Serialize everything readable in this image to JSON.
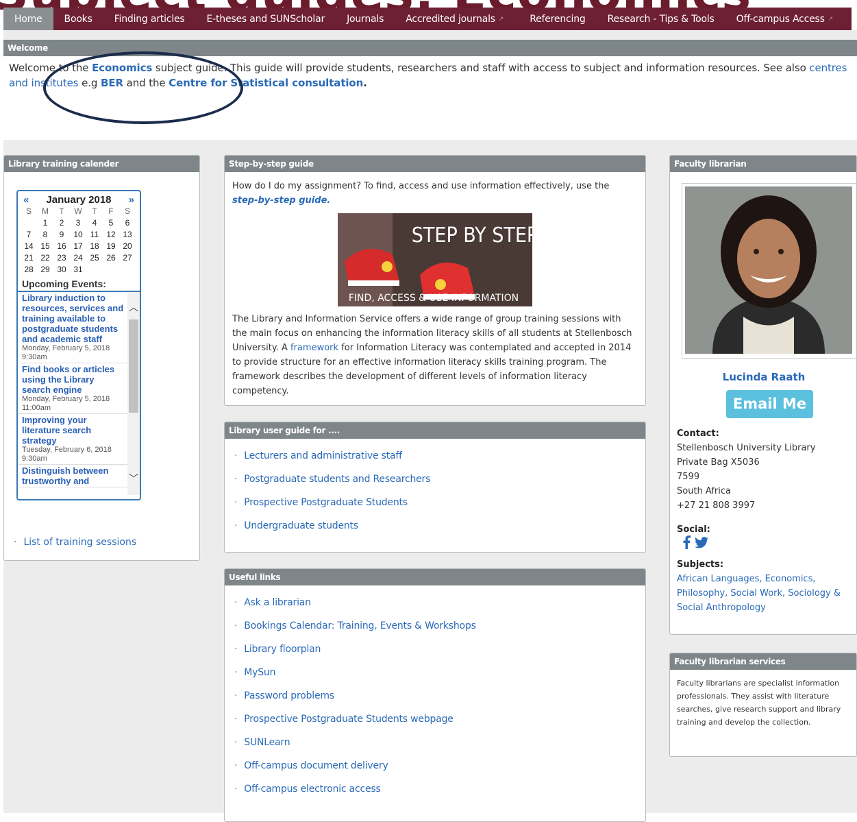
{
  "banner_text": "Subject guides: Economics",
  "nav": {
    "tabs": [
      {
        "label": "Home"
      },
      {
        "label": "Books"
      },
      {
        "label": "Finding articles"
      },
      {
        "label": "E-theses and SUNScholar"
      },
      {
        "label": "Journals"
      },
      {
        "label": "Accredited journals"
      },
      {
        "label": "Referencing"
      },
      {
        "label": "Research - Tips & Tools"
      },
      {
        "label": "Off-campus Access"
      }
    ]
  },
  "welcome": {
    "header": "Welcome",
    "t1": "Welcome to the ",
    "economics": "Economics",
    "t2": " subject guide. This guide will provide students, researchers and staff with access to subject and information resources. See also ",
    "centres": "centres and institutes",
    "t3": " e.g ",
    "ber": "BER",
    "t4": " and the ",
    "centre": "Centre for Statistical consultation",
    "t5": "."
  },
  "training": {
    "header": "Library training calender",
    "month": "January 2018",
    "prev": "«",
    "next": "»",
    "dows": [
      "S",
      "M",
      "T",
      "W",
      "T",
      "F",
      "S"
    ],
    "days": [
      "",
      "1",
      "2",
      "3",
      "4",
      "5",
      "6",
      "7",
      "8",
      "9",
      "10",
      "11",
      "12",
      "13",
      "14",
      "15",
      "16",
      "17",
      "18",
      "19",
      "20",
      "21",
      "22",
      "23",
      "24",
      "25",
      "26",
      "27",
      "28",
      "29",
      "30",
      "31",
      "",
      "",
      ""
    ],
    "upcoming_title": "Upcoming Events:",
    "events": [
      {
        "title": "Library induction to resources, services and training available to postgraduate students and academic staff",
        "date": "Monday, February 5, 2018 9:30am"
      },
      {
        "title": "Find books or articles using the Library search engine",
        "date": "Monday, February 5, 2018 11:00am"
      },
      {
        "title": "Improving your literature search strategy",
        "date": "Tuesday, February 6, 2018 9:30am"
      },
      {
        "title": "Distinguish between trustworthy and",
        "date": ""
      }
    ],
    "list_link": "List of training sessions"
  },
  "step": {
    "header": "Step-by-step guide",
    "q": "How do I do my assignment? To find, access and use information effectively, use the ",
    "link": "step-by-step guide.",
    "img_title": "STEP BY STEP",
    "img_sub": "FIND, ACCESS & USE INFORMATION",
    "p1": "The Library and Information Service offers a wide range of group training sessions with the main focus on enhancing the information literacy skills of all students at Stellenbosch University. A ",
    "framework": "framework",
    "p2": " for Information Literacy was contemplated and accepted in 2014 to provide structure for an effective information literacy skills training program. The framework describes the development of different levels of information literacy competency."
  },
  "userguide": {
    "header": "Library user guide for ....",
    "items": [
      "Lecturers and administrative staff",
      "Postgraduate students and Researchers",
      "Prospective Postgraduate Students",
      "Undergraduate students"
    ]
  },
  "links": {
    "header": "Useful links",
    "items": [
      "Ask a librarian",
      "Bookings Calendar: Training, Events & Workshops",
      "Library floorplan",
      "MySun",
      "Password problems",
      "Prospective Postgraduate Students webpage",
      "SUNLearn",
      "Off-campus document delivery",
      "Off-campus electronic access"
    ]
  },
  "faculty": {
    "header": "Faculty librarian",
    "name": "Lucinda Raath",
    "email": "Email Me",
    "contact_label": "Contact:",
    "contact": [
      "Stellenbosch University Library",
      "Private Bag X5036",
      "7599",
      "South Africa",
      "+27 21 808 3997"
    ],
    "social_label": "Social:",
    "subjects_label": "Subjects:",
    "subjects": "African Languages, Economics, Philosophy, Social Work, Sociology & Social Anthropology"
  },
  "services": {
    "header": "Faculty librarian services",
    "text": "Faculty librarians are specialist information professionals. They assist with literature searches, give research support and library training and develop the collection."
  }
}
